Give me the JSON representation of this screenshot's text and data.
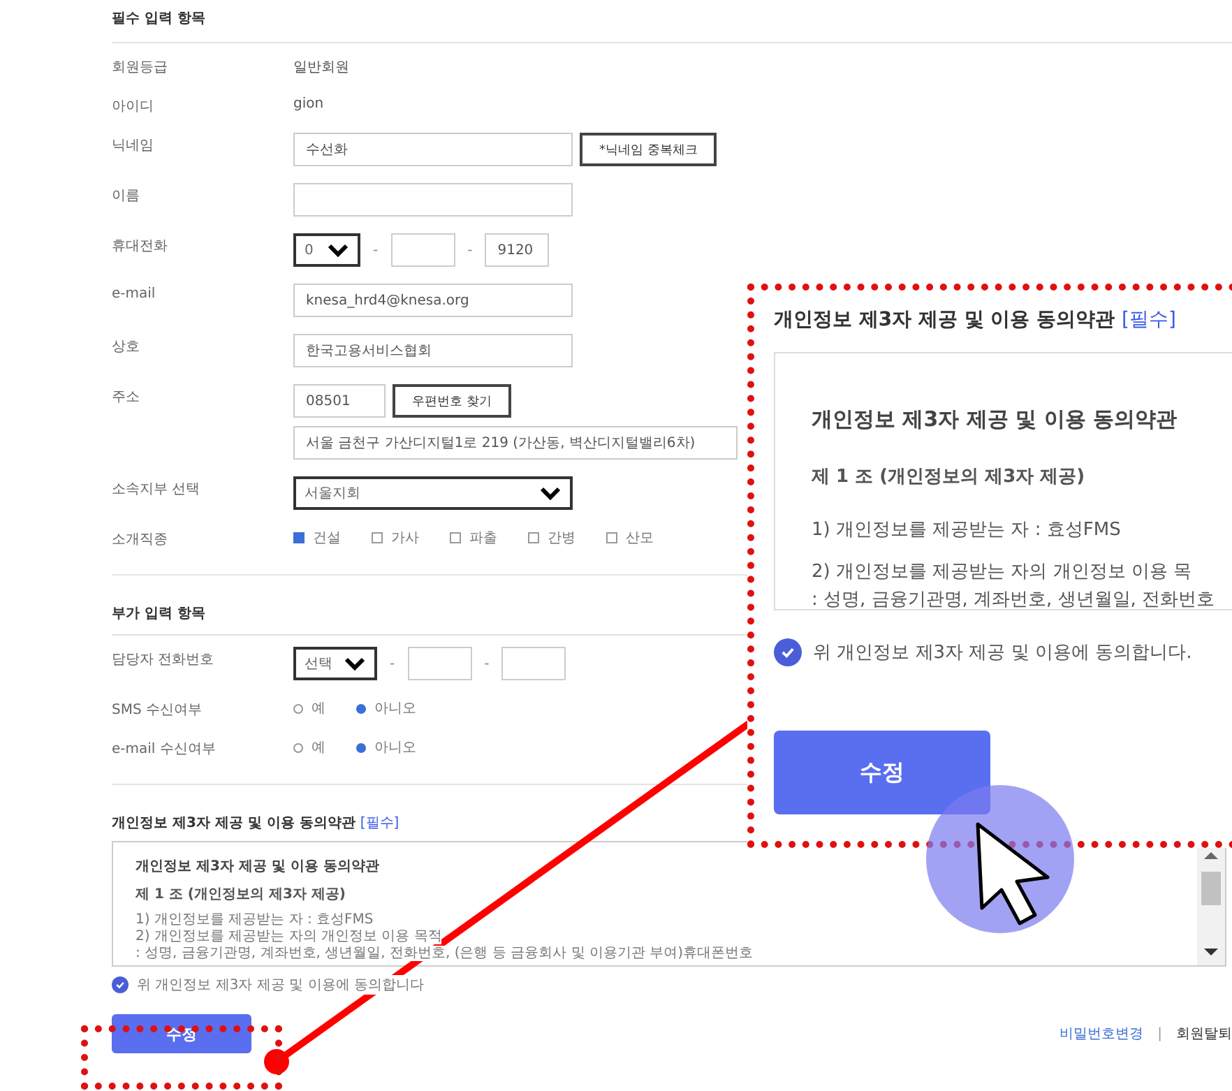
{
  "required_section": {
    "title": "필수 입력 항목",
    "fields": [
      {
        "kind": "static",
        "label": "회원등급",
        "value": "일반회원"
      },
      {
        "kind": "static",
        "label": "아이디",
        "value": "gion"
      },
      {
        "kind": "input",
        "label": "닉네임",
        "value": "수선화",
        "button": "*닉네임 중복체크"
      },
      {
        "kind": "input",
        "label": "이름"
      },
      {
        "kind": "phone",
        "label": "휴대전화",
        "select": "0",
        "separator": "-",
        "last": "9120"
      },
      {
        "kind": "input",
        "label": "e-mail",
        "value": "knesa_hrd4@knesa.org"
      },
      {
        "kind": "input",
        "label": "상호",
        "value": "한국고용서비스협회"
      },
      {
        "kind": "address",
        "label": "주소",
        "zipcode": "08501",
        "button": "우편번호 찾기",
        "address": "서울 금천구 가산디지털1로 219 (가산동, 벽산디지털밸리6차)"
      },
      {
        "kind": "select",
        "label": "소속지부 선택",
        "value": "서울지회"
      },
      {
        "kind": "checkboxes",
        "label": "소개직종",
        "options": [
          {
            "label": "건설",
            "checked": true
          },
          {
            "label": "가사",
            "checked": false
          },
          {
            "label": "파출",
            "checked": false
          },
          {
            "label": "간병",
            "checked": false
          },
          {
            "label": "산모",
            "checked": false
          }
        ]
      }
    ]
  },
  "optional_section": {
    "title": "부가 입력 항목",
    "fields": [
      {
        "kind": "phone",
        "label": "담당자 전화번호",
        "select": "선택",
        "separator": "-"
      },
      {
        "kind": "radios",
        "label": "SMS 수신여부",
        "options": [
          {
            "label": "예",
            "selected": false
          },
          {
            "label": "아니오",
            "selected": true
          }
        ]
      },
      {
        "kind": "radios",
        "label": "e-mail 수신여부",
        "options": [
          {
            "label": "예",
            "selected": false
          },
          {
            "label": "아니오",
            "selected": true
          }
        ]
      }
    ]
  },
  "terms": {
    "title": "개인정보 제3자 제공 및 이용 동의약관",
    "tag": "[필수]",
    "heading": "개인정보 제3자 제공 및 이용 동의약관",
    "article": "제 1 조 (개인정보의 제3자 제공)",
    "lines": [
      "1) 개인정보를 제공받는 자 : 효성FMS",
      "2) 개인정보를 제공받는 자의 개인정보 이용 목적",
      ": 성명, 금융기관명, 계좌번호, 생년월일, 전화번호, (은행 등 금융회사 및 이용기관 부여)휴대폰번호"
    ],
    "agree": {
      "label": "위 개인정보 제3자 제공 및 이용에 동의합니다",
      "checked": true
    }
  },
  "submit_button": "수정",
  "footer_links": [
    {
      "label": "비밀번호변경"
    },
    {
      "label": "회원탈퇴"
    }
  ],
  "footer_separator": "|",
  "callout": {
    "title": "개인정보 제3자 제공 및 이용 동의약관",
    "tag": "[필수]",
    "heading": "개인정보 제3자 제공 및 이용 동의약관",
    "article": "제 1 조 (개인정보의 제3자 제공)",
    "lines": [
      "1) 개인정보를 제공받는 자 : 효성FMS",
      "2) 개인정보를 제공받는 자의 개인정보 이용 목",
      ": 성명, 금융기관명, 계좌번호, 생년월일, 전화번호"
    ],
    "agree": {
      "label": "위 개인정보 제3자 제공 및 이용에 동의합니다.",
      "checked": true
    },
    "button": "수정"
  }
}
